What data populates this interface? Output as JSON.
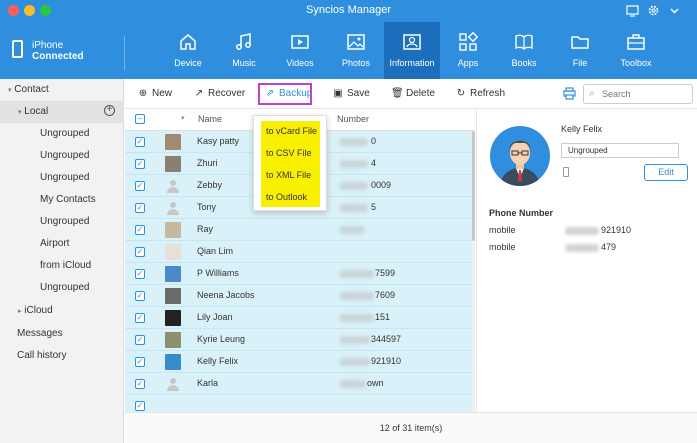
{
  "window": {
    "title": "Syncios Manager"
  },
  "device": {
    "name": "iPhone",
    "status": "Connected"
  },
  "nav": [
    {
      "label": "Device",
      "icon": "home-icon"
    },
    {
      "label": "Music",
      "icon": "music-icon"
    },
    {
      "label": "Videos",
      "icon": "video-icon"
    },
    {
      "label": "Photos",
      "icon": "photo-icon"
    },
    {
      "label": "Information",
      "icon": "contact-card-icon",
      "active": true
    },
    {
      "label": "Apps",
      "icon": "apps-icon"
    },
    {
      "label": "Books",
      "icon": "book-icon"
    },
    {
      "label": "File",
      "icon": "folder-icon"
    },
    {
      "label": "Toolbox",
      "icon": "toolbox-icon"
    }
  ],
  "sidebar": {
    "contact": "Contact",
    "local": "Local",
    "groups": [
      "Ungrouped",
      "Ungrouped",
      "Ungrouped",
      "My Contacts",
      "Ungrouped",
      "Airport",
      "from iCloud",
      "Ungrouped"
    ],
    "icloud": "iCloud",
    "messages": "Messages",
    "call_history": "Call history"
  },
  "toolbar": {
    "new": "New",
    "recover": "Recover",
    "backup": "Backup",
    "save": "Save",
    "delete": "Delete",
    "refresh": "Refresh",
    "search_placeholder": "Search"
  },
  "table": {
    "col_name": "Name",
    "col_number": "Number",
    "rows": [
      {
        "name": "Kasy patty",
        "number_tail": "0",
        "avatar": "photo"
      },
      {
        "name": "Zhuri",
        "number_tail": "4",
        "avatar": "photo"
      },
      {
        "name": "Zebby",
        "number_tail": "0009",
        "avatar": "default"
      },
      {
        "name": "Tony",
        "number_tail": "5",
        "avatar": "default"
      },
      {
        "name": "Ray",
        "number_tail": "",
        "avatar": "photo"
      },
      {
        "name": "Qian Lim",
        "number_tail": "",
        "avatar": "photo"
      },
      {
        "name": "P Williams",
        "number_tail": "7599",
        "avatar": "photo"
      },
      {
        "name": "Neena Jacobs",
        "number_tail": "7609",
        "avatar": "photo"
      },
      {
        "name": "Lily Joan",
        "number_tail": "151",
        "avatar": "photo"
      },
      {
        "name": "Kyrie Leung",
        "number_tail": "344597",
        "avatar": "photo"
      },
      {
        "name": "Kelly Felix",
        "number_tail": "921910",
        "avatar": "photo"
      },
      {
        "name": "Karla",
        "number_tail": "own",
        "avatar": "default"
      }
    ]
  },
  "backup_menu": [
    "to vCard File",
    "to CSV File",
    "to XML File",
    "to Outlook"
  ],
  "detail": {
    "name": "Kelly Felix",
    "group": "Ungrouped",
    "edit": "Edit",
    "phone_section": "Phone Number",
    "phones": [
      {
        "label": "mobile",
        "tail": "921910"
      },
      {
        "label": "mobile",
        "tail": "479"
      }
    ]
  },
  "status": "12 of 31 item(s)",
  "colors": {
    "accent": "#2f8fde",
    "active_nav": "#1c6fbd",
    "row_selected": "#d9f1f8",
    "highlight": "#f8f000",
    "backup_outline": "#c040d0"
  }
}
